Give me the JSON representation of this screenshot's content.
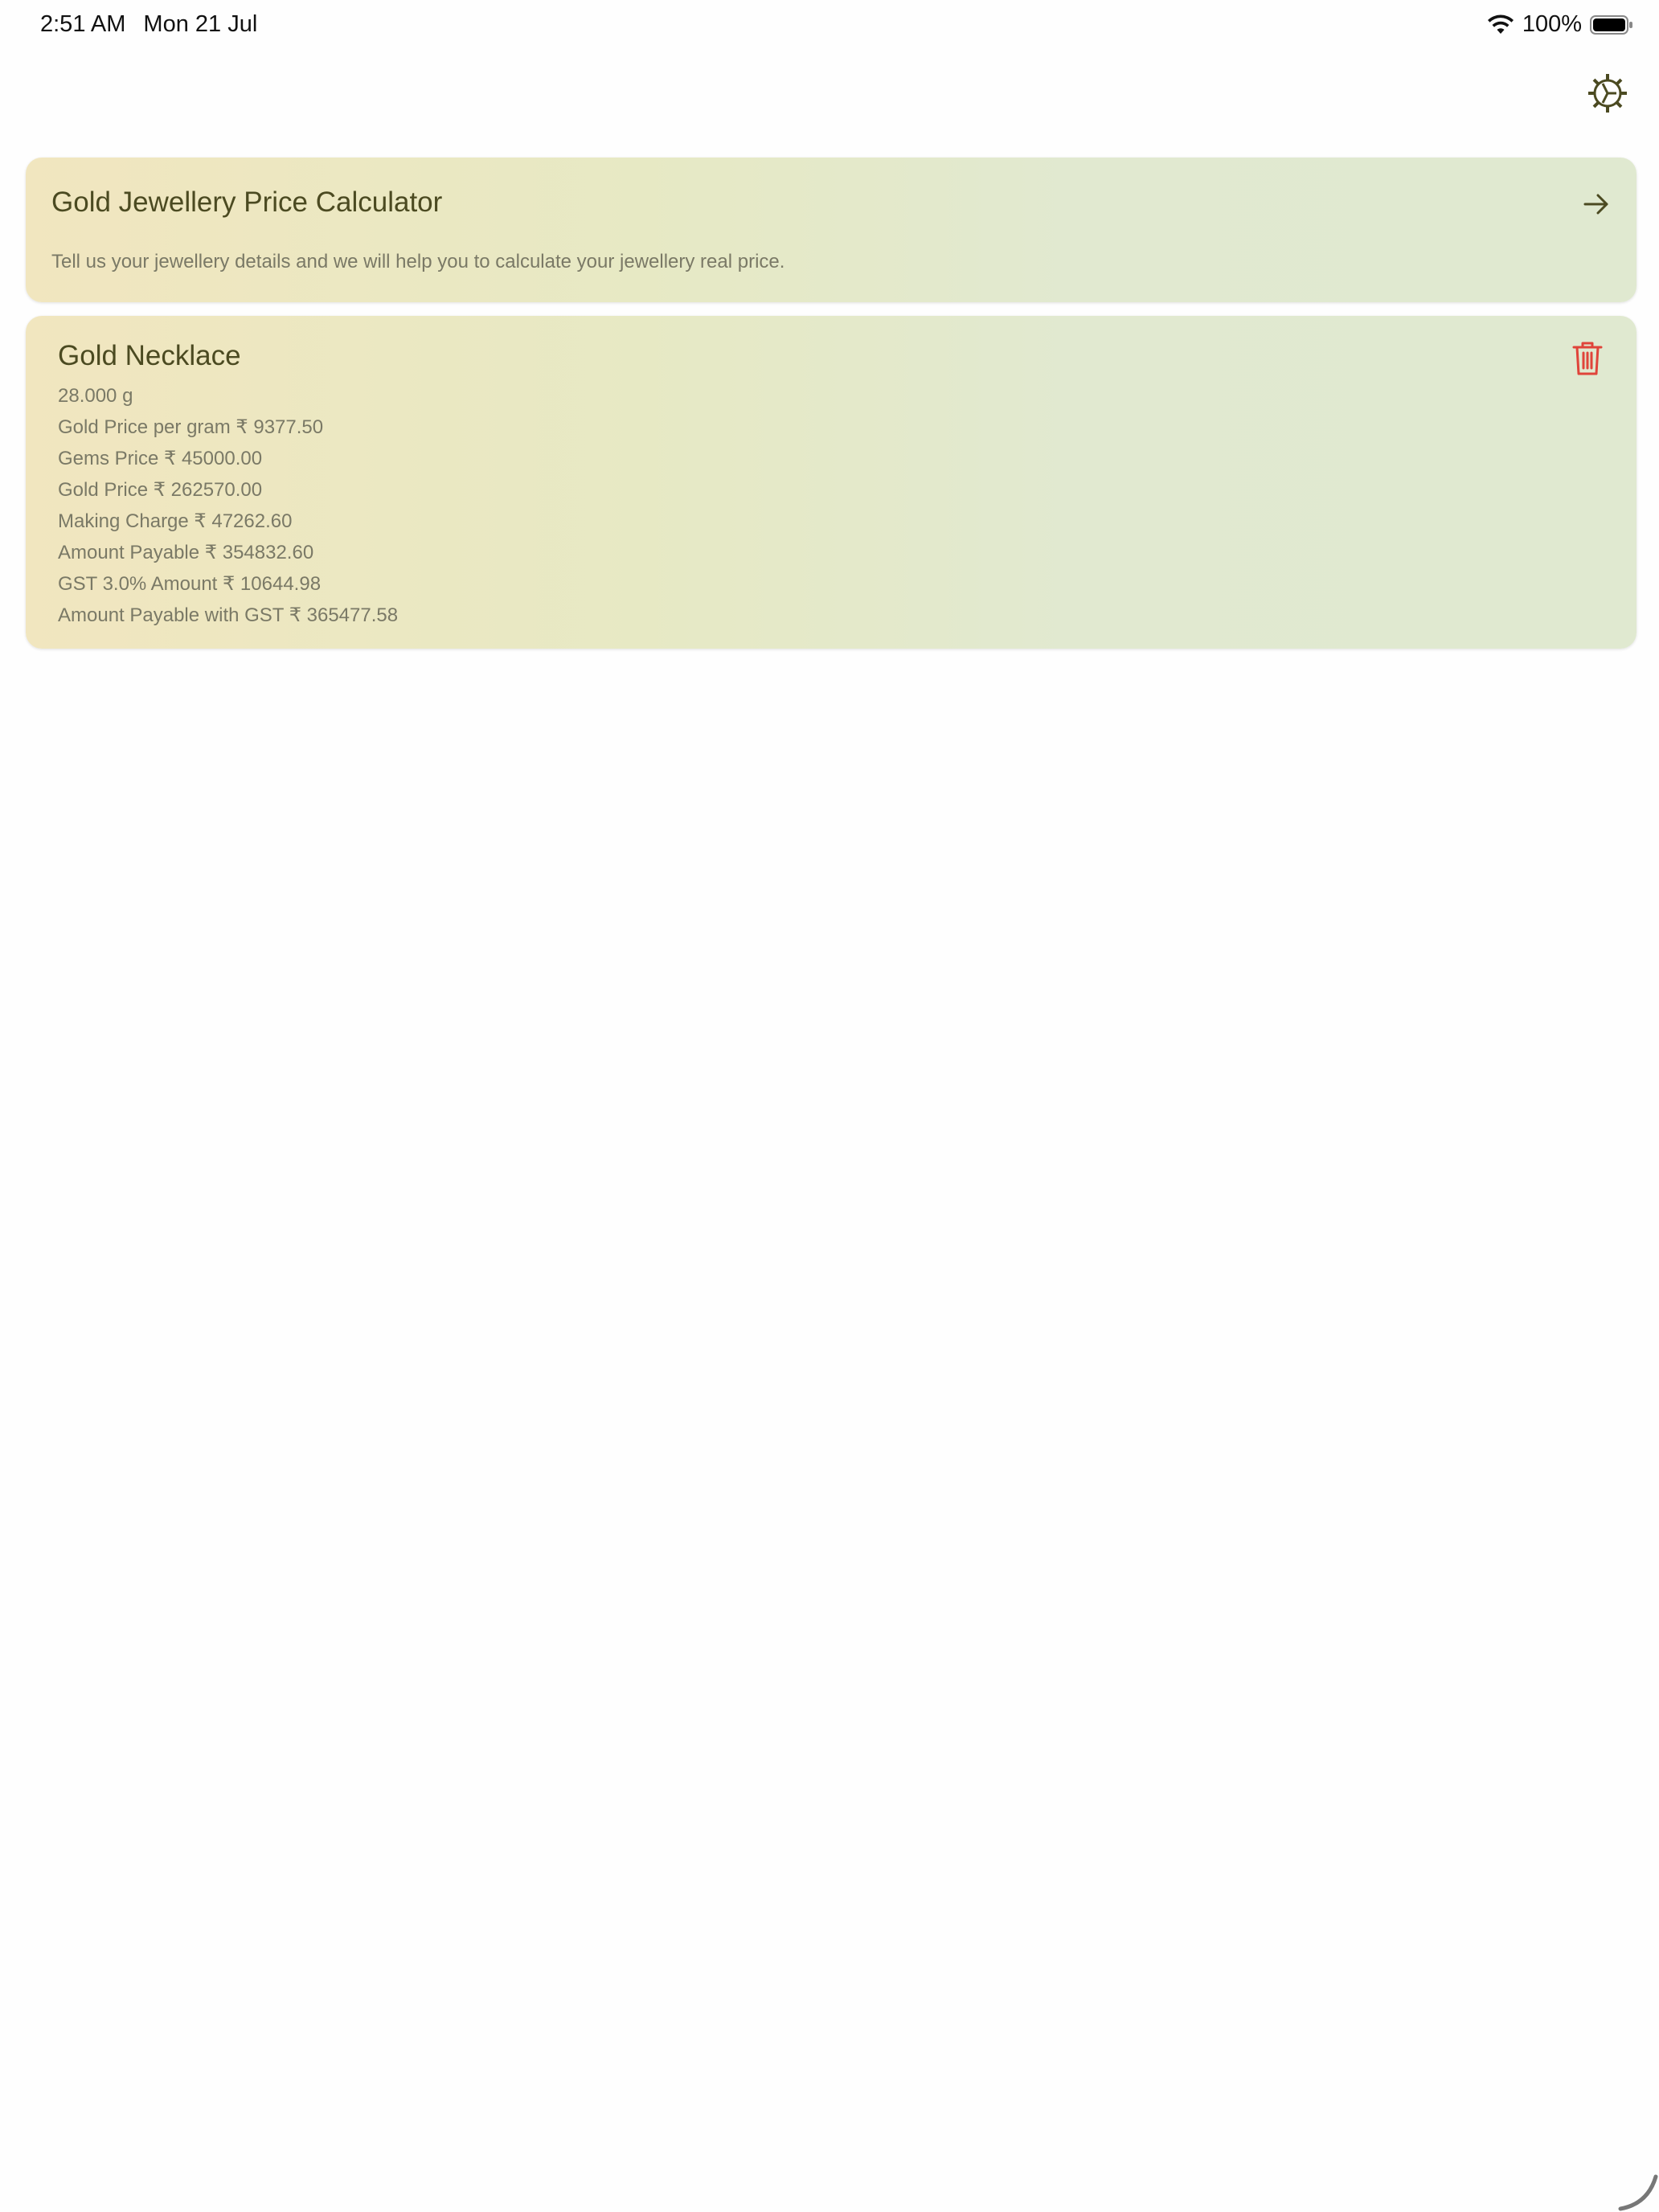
{
  "status_bar": {
    "time": "2:51 AM",
    "date": "Mon 21 Jul",
    "battery": "100%"
  },
  "icons": {
    "settings": "gear-icon",
    "arrow": "arrow-right-icon",
    "delete": "trash-icon",
    "wifi": "wifi-icon",
    "battery": "battery-icon"
  },
  "calculator_card": {
    "title": "Gold Jewellery Price Calculator",
    "subtitle": "Tell us your jewellery details and we will help you to calculate your jewellery real price."
  },
  "items": [
    {
      "title": "Gold Necklace",
      "weight": "28.000 g",
      "gold_price_per_gram": "Gold Price per gram ₹ 9377.50",
      "gems_price": "Gems Price ₹ 45000.00",
      "gold_price": "Gold Price ₹ 262570.00",
      "making_charge": "Making Charge ₹ 47262.60",
      "amount_payable": "Amount Payable ₹ 354832.60",
      "gst_amount": "GST 3.0% Amount ₹ 10644.98",
      "amount_with_gst": "Amount Payable with GST ₹ 365477.58"
    }
  ],
  "colors": {
    "title": "#4b4a21",
    "body_text": "#7a7966",
    "delete": "#e0443a",
    "card_gradient_start": "#f1e6bf",
    "card_gradient_end": "#e0e9d0"
  }
}
